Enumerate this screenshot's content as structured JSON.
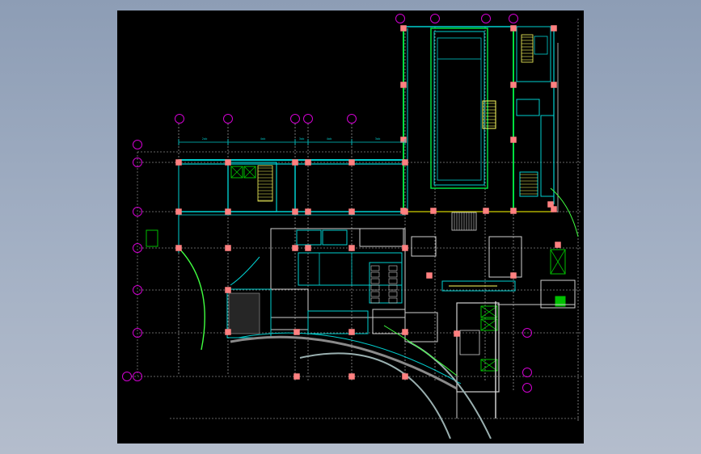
{
  "window": {
    "title": "",
    "background": "#000000"
  },
  "drawing": {
    "kind": "architectural floor plan",
    "dimension_labels": [
      "2ab",
      "4ab",
      "3ab",
      "4ab",
      "3ab"
    ],
    "colors": {
      "grid_axis": "#c8c8c8",
      "axis_bubble": "#d000d0",
      "wall": "#00d0d0",
      "wall_alt": "#00e040",
      "column": "#ff8080",
      "arc": "#40ff40",
      "stair": "#ffff60",
      "furniture": "#d0d0d0",
      "green_block": "#00c000"
    }
  }
}
